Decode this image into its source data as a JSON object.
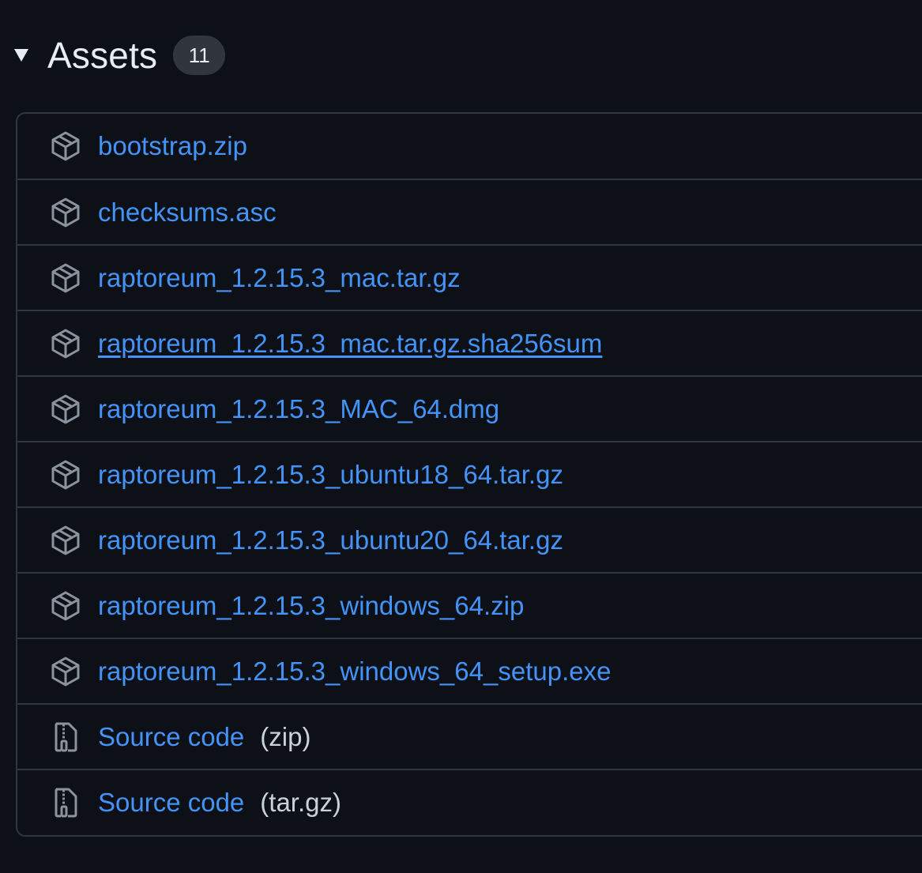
{
  "assets": {
    "title": "Assets",
    "count": "11",
    "items": [
      {
        "label": "bootstrap.zip",
        "icon": "package-icon"
      },
      {
        "label": "checksums.asc",
        "icon": "package-icon"
      },
      {
        "label": "raptoreum_1.2.15.3_mac.tar.gz",
        "icon": "package-icon"
      },
      {
        "label": "raptoreum_1.2.15.3_mac.tar.gz.sha256sum",
        "icon": "package-icon"
      },
      {
        "label": "raptoreum_1.2.15.3_MAC_64.dmg",
        "icon": "package-icon"
      },
      {
        "label": "raptoreum_1.2.15.3_ubuntu18_64.tar.gz",
        "icon": "package-icon"
      },
      {
        "label": "raptoreum_1.2.15.3_ubuntu20_64.tar.gz",
        "icon": "package-icon"
      },
      {
        "label": "raptoreum_1.2.15.3_windows_64.zip",
        "icon": "package-icon"
      },
      {
        "label": "raptoreum_1.2.15.3_windows_64_setup.exe",
        "icon": "package-icon"
      },
      {
        "label": "Source code",
        "suffix": "(zip)",
        "icon": "file-zip-icon"
      },
      {
        "label": "Source code",
        "suffix": "(tar.gz)",
        "icon": "file-zip-icon"
      }
    ]
  },
  "colors": {
    "background": "#0d1117",
    "link": "#4493f8",
    "border": "#30363d",
    "text": "#e6edf3",
    "badge": "#31363d"
  }
}
